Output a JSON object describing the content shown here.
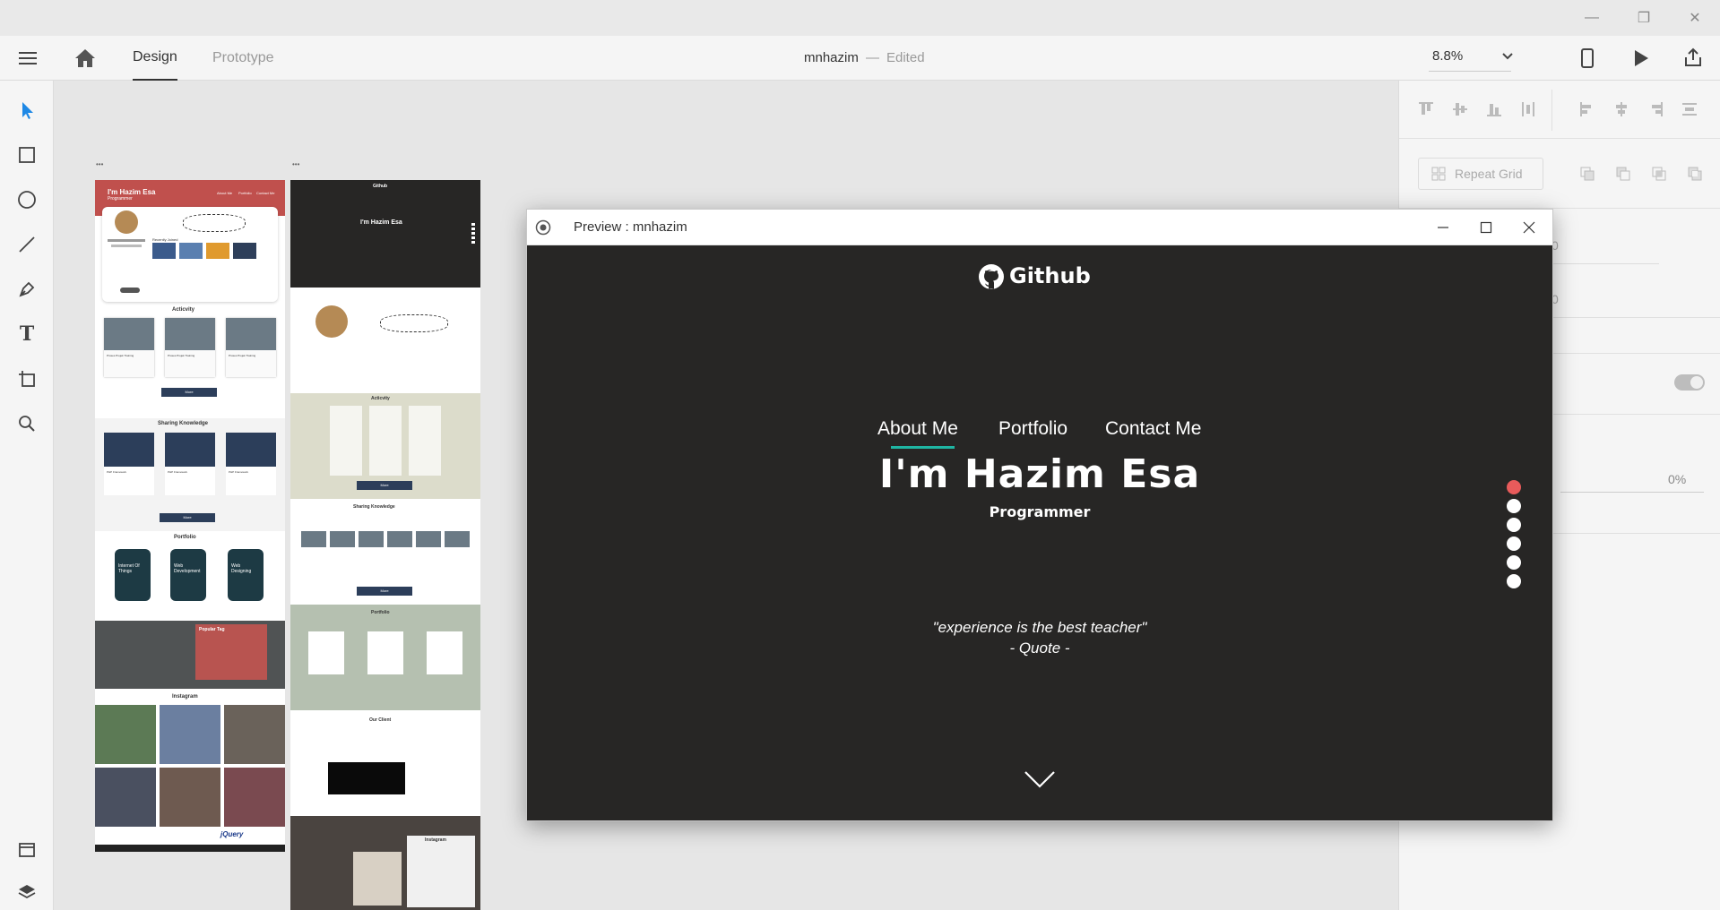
{
  "window": {
    "minimize_glyph": "—",
    "maximize_glyph": "❐",
    "close_glyph": "✕"
  },
  "toolbar": {
    "tabs": [
      {
        "label": "Design",
        "active": true
      },
      {
        "label": "Prototype",
        "active": false
      }
    ],
    "doc_name": "mnhazim",
    "doc_sep": "—",
    "doc_status": "Edited",
    "zoom": "8.8%"
  },
  "right_panel": {
    "repeat_grid_label": "Repeat Grid",
    "value_a": "0",
    "value_b": "0",
    "opacity": "0%"
  },
  "artboard_a": {
    "header_title": "I'm Hazim Esa",
    "header_sub": "Programmer",
    "nav": [
      "About Me",
      "Portfolio",
      "Contact Me"
    ],
    "recently_label": "Recently Joined",
    "activity_title": "Acticvity",
    "activity_caption": "Proses Projek Training",
    "more": "More",
    "sharing_title": "Sharing Knowledge",
    "sharing_caption": "PHP Framework",
    "portfolio_title": "Portfolio",
    "portfolio_cards": [
      "Internet Of Things",
      "Web Development",
      "Web Designing"
    ],
    "popular_tag_title": "Popular Tag",
    "instagram_title": "Instagram",
    "footer_logos": "jQuery"
  },
  "artboard_b": {
    "brand": "Github",
    "title": "I'm Hazim Esa",
    "activity_title": "Acticvity",
    "more": "More",
    "sharing_title": "Sharing Knowledge",
    "portfolio_title": "Portfolio",
    "client_title": "Our Client",
    "instagram_title": "Instagram"
  },
  "preview": {
    "window_title": "Preview : mnhazim",
    "brand": "Github",
    "nav": [
      "About Me",
      "Portfolio",
      "Contact Me"
    ],
    "active_nav": "About Me",
    "hero_title": "I'm Hazim Esa",
    "hero_subtitle": "Programmer",
    "quote": "\"experience is the best teacher\"",
    "quote_author": "- Quote -",
    "nav_dots": 6,
    "active_dot": 1,
    "colors": {
      "background": "#272625",
      "accent_underline": "#1fb5a3",
      "active_dot": "#e85b5b",
      "header_red": "#c0504d"
    }
  }
}
